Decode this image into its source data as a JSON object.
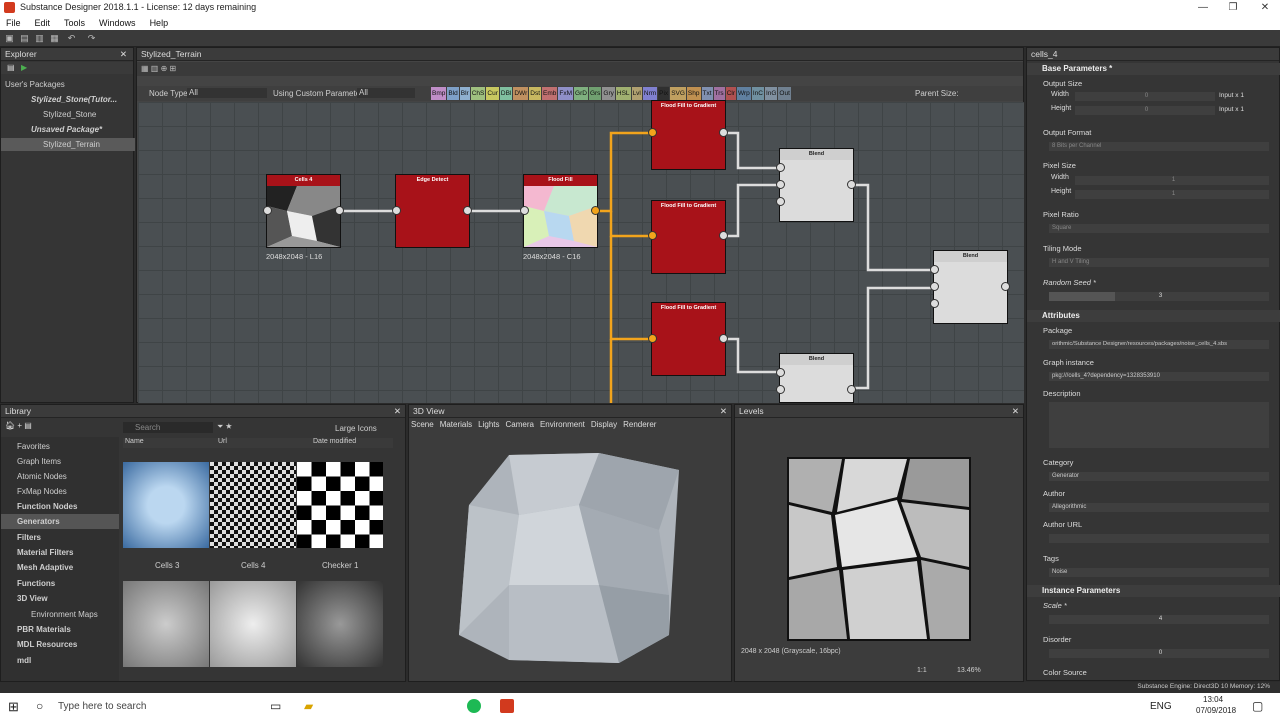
{
  "window": {
    "title": "Substance Designer 2018.1.1 - License: 12 days remaining"
  },
  "menu": [
    "File",
    "Edit",
    "Tools",
    "Windows",
    "Help"
  ],
  "explorer": {
    "title": "Explorer",
    "section": "User's Packages",
    "items": [
      "Stylized_Stone(Tutor...",
      "Stylized_Stone",
      "Unsaved Package*",
      "Stylized_Terrain"
    ]
  },
  "graph": {
    "tab": "Stylized_Terrain",
    "node_type_label": "Node Type",
    "node_type_value": "All",
    "custom_params_label": "Using Custom Parameters",
    "custom_params_value": "All",
    "parent_size": "Parent Size:",
    "filter_chips": [
      "Bmp",
      "Bld",
      "Blr",
      "ChS",
      "Cur",
      "DBl",
      "DWr",
      "Dst",
      "Emb",
      "FxM",
      "GrD",
      "Grs",
      "Gry",
      "HSL",
      "Lvl",
      "Nrm",
      "Pix",
      "SVG",
      "Shp",
      "Txt",
      "Trs",
      "Clr",
      "Wrp",
      "InC",
      "InG",
      "Out"
    ],
    "nodes": {
      "cells4": {
        "title": "Cells 4",
        "label": "2048x2048 - L16"
      },
      "edge": {
        "title": "Edge Detect"
      },
      "flood": {
        "title": "Flood Fill",
        "label": "2048x2048 - C16"
      },
      "ffg1": {
        "title": "Flood Fill to Gradient"
      },
      "ffg2": {
        "title": "Flood Fill to Gradient"
      },
      "ffg3": {
        "title": "Flood Fill to Gradient"
      },
      "blend1": {
        "title": "Blend"
      },
      "blend2": {
        "title": "Blend"
      },
      "blend3": {
        "title": "Blend"
      }
    }
  },
  "props": {
    "tab": "cells_4",
    "base": "Base Parameters *",
    "output_size": "Output Size",
    "width": "Width",
    "height": "Height",
    "width_val": "0",
    "height_val": "0",
    "input_x1": "Input x 1",
    "output_format": "Output Format",
    "output_format_val": "8 Bits per Channel",
    "pixel_size": "Pixel Size",
    "pixel_size_val": "1",
    "pixel_ratio": "Pixel Ratio",
    "pixel_ratio_val": "Square",
    "tiling_mode": "Tiling Mode",
    "tiling_mode_val": "H and V Tiling",
    "random_seed": "Random Seed *",
    "random_seed_val": "3",
    "attributes": "Attributes",
    "package": "Package",
    "package_val": "orithmic/Substance Designer/resources/packages/noise_cells_4.sbs",
    "graph_instance": "Graph instance",
    "graph_instance_val": "pkg:///cells_4?dependency=1328353910",
    "description": "Description",
    "category": "Category",
    "category_val": "Generator",
    "author": "Author",
    "author_val": "Allegorithmic",
    "author_url": "Author URL",
    "tags": "Tags",
    "tags_val": "Noise",
    "instance": "Instance Parameters",
    "scale": "Scale *",
    "scale_val": "4",
    "disorder": "Disorder",
    "disorder_val": "0",
    "color_source": "Color Source"
  },
  "library": {
    "title": "Library",
    "search_placeholder": "Search",
    "view_mode": "Large Icons",
    "cols": [
      "Name",
      "Url",
      "Date modified"
    ],
    "categories": [
      "Favorites",
      "Graph Items",
      "Atomic Nodes",
      "FxMap Nodes",
      "Function Nodes",
      "Generators",
      "Filters",
      "Material Filters",
      "Mesh Adaptive",
      "Functions",
      "3D View",
      "Environment Maps",
      "PBR Materials",
      "MDL Resources",
      "mdl"
    ],
    "thumbs": [
      "Cells 3",
      "Cells 4",
      "Checker 1"
    ]
  },
  "view3d": {
    "title": "3D View",
    "menu": [
      "Scene",
      "Materials",
      "Lights",
      "Camera",
      "Environment",
      "Display",
      "Renderer"
    ]
  },
  "levels": {
    "title": "Levels",
    "info": "2048 x 2048 (Grayscale, 16bpc)",
    "zoom": "13.46%",
    "ratio": "1:1"
  },
  "status": {
    "engine": "Substance Engine: Direct3D 10  Memory: 12%"
  },
  "taskbar": {
    "search": "Type here to search",
    "lang": "ENG",
    "time": "13:04",
    "date": "07/09/2018"
  }
}
